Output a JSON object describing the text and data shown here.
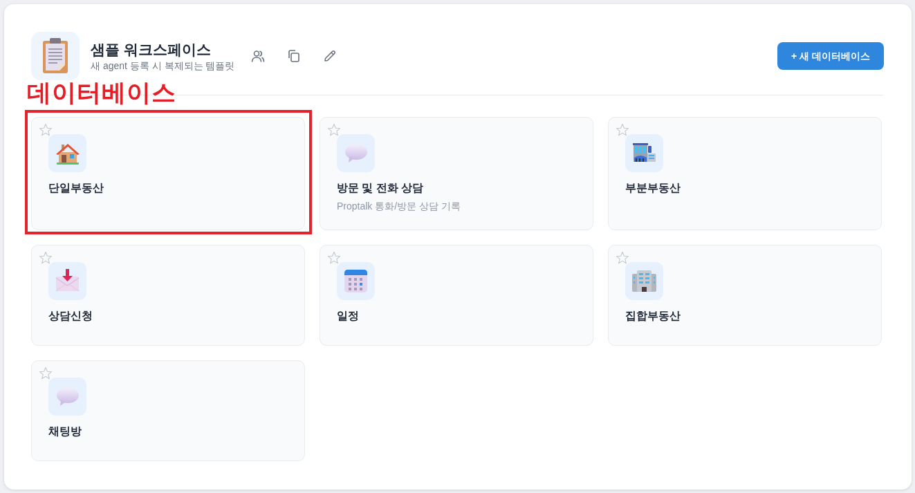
{
  "workspace": {
    "title": "샘플 워크스페이스",
    "subtitle": "새 agent 등록 시 복제되는 템플릿"
  },
  "new_database_button": {
    "label": "+ 새 데이터베이스"
  },
  "annotation": {
    "label": "데이터베이스"
  },
  "databases": [
    {
      "title": "단일부동산",
      "starred": false,
      "highlighted": true
    },
    {
      "title": "방문 및 전화 상담",
      "description": "Proptalk 통화/방문 상담 기록",
      "starred": false,
      "highlighted": false
    },
    {
      "title": "부분부동산",
      "starred": false,
      "highlighted": false
    },
    {
      "title": "상담신청",
      "starred": false,
      "highlighted": false
    },
    {
      "title": "일정",
      "starred": false,
      "highlighted": false
    },
    {
      "title": "집합부동산",
      "starred": false,
      "highlighted": false
    },
    {
      "title": "채팅방",
      "starred": false,
      "highlighted": false
    }
  ]
}
